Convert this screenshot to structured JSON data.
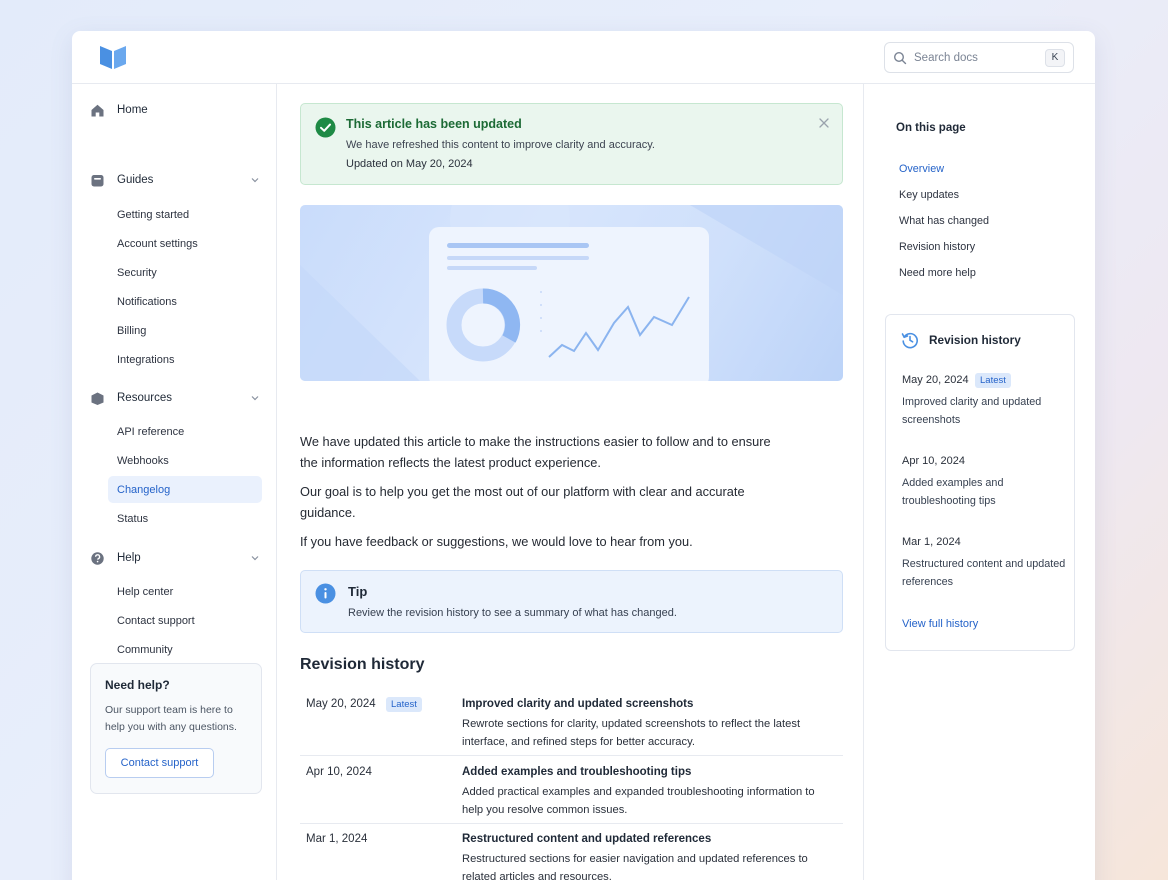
{
  "search": {
    "placeholder": "Search docs",
    "shortcut": "K"
  },
  "sidebar": {
    "home": "Home",
    "guides": {
      "label": "Guides",
      "items": [
        "Getting started",
        "Account settings",
        "Security",
        "Notifications",
        "Billing",
        "Integrations"
      ]
    },
    "resources": {
      "label": "Resources",
      "items": [
        "API reference",
        "Webhooks",
        "Changelog",
        "Status"
      ],
      "active": "Changelog"
    },
    "help": {
      "label": "Help",
      "items": [
        "Help center",
        "Contact support",
        "Community"
      ]
    },
    "helpbox": {
      "title": "Need help?",
      "desc": "Our support team is here to help you with any questions.",
      "button": "Contact support"
    }
  },
  "alert": {
    "title": "This article has been updated",
    "desc": "We have refreshed this content to improve clarity and accuracy.",
    "updated": "Updated on May 20, 2024"
  },
  "body": {
    "p1": "We have updated this article to make the instructions easier to follow and to ensure the information reflects the latest product experience.",
    "p2": "Our goal is to help you get the most out of our platform with clear and accurate guidance.",
    "p3": "If you have feedback or suggestions, we would love to hear from you."
  },
  "tip": {
    "title": "Tip",
    "text": "Review the revision history to see a summary of what has changed."
  },
  "revision_history": {
    "title": "Revision history",
    "latest_badge": "Latest",
    "rows": [
      {
        "date": "May 20, 2024",
        "title": "Improved clarity and updated screenshots",
        "desc": "Rewrote sections for clarity, updated screenshots to reflect the latest interface, and refined steps for better accuracy."
      },
      {
        "date": "Apr 10, 2024",
        "title": "Added examples and troubleshooting tips",
        "desc": "Added practical examples and expanded troubleshooting information to help you resolve common issues."
      },
      {
        "date": "Mar 1, 2024",
        "title": "Restructured content and updated references",
        "desc": "Restructured sections for easier navigation and updated references to related articles and resources."
      }
    ]
  },
  "toc": {
    "title": "On this page",
    "items": [
      "Overview",
      "Key updates",
      "What has changed",
      "Revision history",
      "Need more help"
    ]
  },
  "revision_card": {
    "title": "Revision history",
    "items": [
      {
        "date": "May 20, 2024",
        "text": "Improved clarity and updated screenshots"
      },
      {
        "date": "Apr 10, 2024",
        "text": "Added examples and troubleshooting tips"
      },
      {
        "date": "Mar 1, 2024",
        "text": "Restructured content and updated references"
      }
    ],
    "link": "View full history"
  },
  "colors": {
    "accent": "#2563c9",
    "success": "#1c6a35",
    "success_bg": "#eaf6ee",
    "info_bg": "#ecf3fd"
  },
  "icons": [
    "book-logo-icon",
    "search-icon",
    "home-icon",
    "guides-icon",
    "resources-icon",
    "help-icon",
    "chevron-down-icon",
    "check-circle-icon",
    "close-icon",
    "info-icon",
    "history-icon"
  ]
}
